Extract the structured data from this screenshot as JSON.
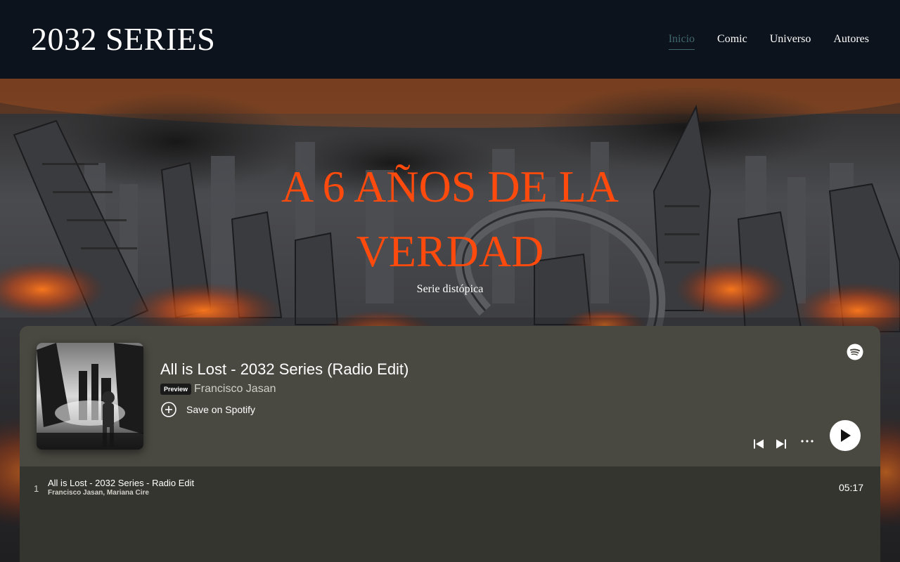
{
  "site": {
    "title": "2032 SERIES"
  },
  "nav": {
    "items": [
      {
        "label": "Inicio",
        "active": true
      },
      {
        "label": "Comic",
        "active": false
      },
      {
        "label": "Universo",
        "active": false
      },
      {
        "label": "Autores",
        "active": false
      }
    ]
  },
  "hero": {
    "title_line1": "A 6 AÑOS DE LA",
    "title_line2": "VERDAD",
    "subtitle": "Serie distópica",
    "title_color": "#ff4a0e"
  },
  "player": {
    "track_title": "All is Lost - 2032 Series (Radio Edit)",
    "preview_badge": "Preview",
    "artist": "Francisco Jasan",
    "save_label": "Save on Spotify",
    "icons": [
      "spotify-icon",
      "add-circle-icon",
      "skip-previous-icon",
      "skip-next-icon",
      "more-icon",
      "play-icon"
    ],
    "tracks": [
      {
        "number": "1",
        "title": "All is Lost - 2032 Series - Radio Edit",
        "artists": "Francisco Jasan, Mariana Cire",
        "duration": "05:17"
      }
    ],
    "colors": {
      "header_bg": "#4a4941",
      "list_bg": "#35352f"
    }
  }
}
